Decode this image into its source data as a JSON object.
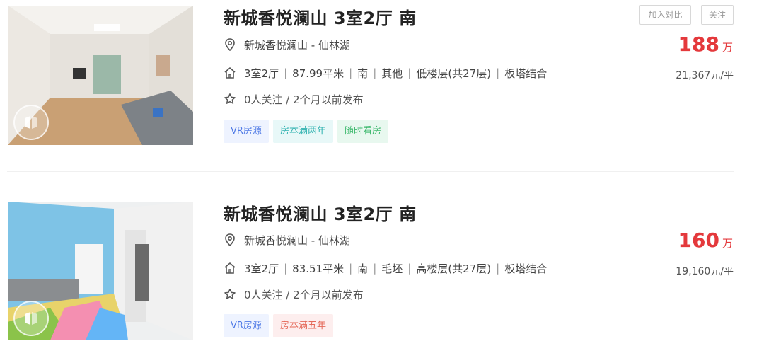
{
  "listings": [
    {
      "title": "新城香悦澜山 3室2厅 南",
      "location": "新城香悦澜山 - 仙林湖",
      "attributes": [
        "3室2厅",
        "87.99平米",
        "南",
        "其他",
        "低楼层(共27层)",
        "板塔结合"
      ],
      "follow_info": "0人关注 / 2个月以前发布",
      "tags": [
        {
          "label": "VR房源",
          "color": "#4f7ae6"
        },
        {
          "label": "房本满两年",
          "color": "#2fb2b0"
        },
        {
          "label": "随时看房",
          "color": "#3cb86c"
        }
      ],
      "price": "188",
      "price_unit": "万",
      "unit_price": "21,367元/平",
      "compare_button": "加入对比",
      "follow_button": "关注"
    },
    {
      "title": "新城香悦澜山 3室2厅 南",
      "location": "新城香悦澜山 - 仙林湖",
      "attributes": [
        "3室2厅",
        "83.51平米",
        "南",
        "毛坯",
        "高楼层(共27层)",
        "板塔结合"
      ],
      "follow_info": "0人关注 / 2个月以前发布",
      "tags": [
        {
          "label": "VR房源",
          "color": "#4f7ae6"
        },
        {
          "label": "房本满五年",
          "color": "#e56b5b"
        }
      ],
      "price": "160",
      "price_unit": "万",
      "unit_price": "19,160元/平"
    }
  ],
  "icons": {
    "location": "location-pin-icon",
    "house": "house-icon",
    "star": "star-icon",
    "vr": "vr-badge-icon"
  },
  "colors": {
    "price": "#e4393c"
  }
}
